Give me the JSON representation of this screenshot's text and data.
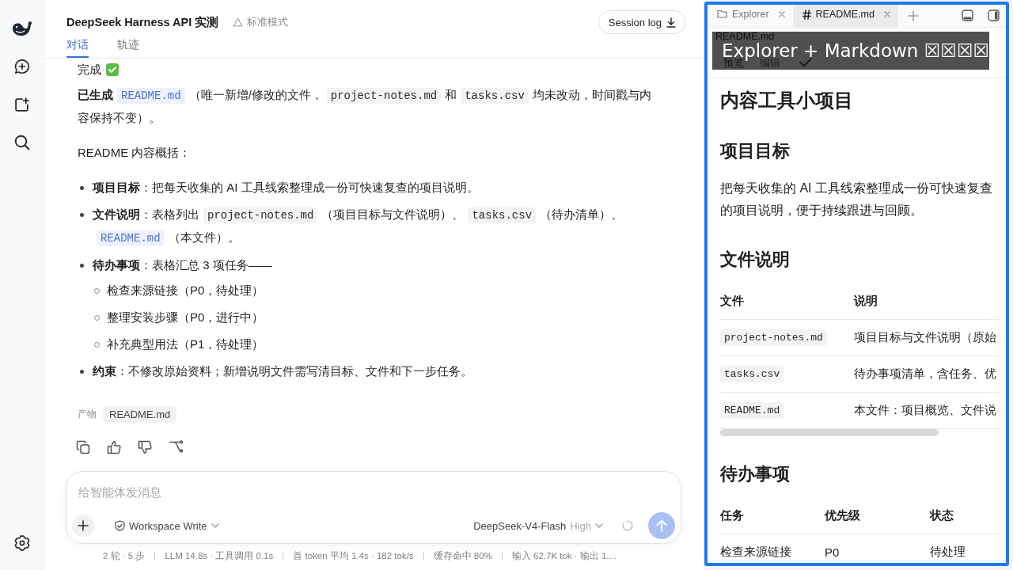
{
  "header": {
    "title": "DeepSeek Harness API 实测",
    "mode": "标准模式",
    "session_button": "Session log",
    "tabs": [
      {
        "label": "对话",
        "selected": true
      },
      {
        "label": "轨迹",
        "selected": false
      }
    ]
  },
  "message": {
    "status": "完成",
    "paragraph": [
      {
        "kind": "bold",
        "text": "已生成"
      },
      {
        "kind": "link",
        "text": "README.md"
      },
      {
        "kind": "text",
        "text": "（唯一新增/修改的文件，"
      },
      {
        "kind": "code",
        "text": "project-notes.md"
      },
      {
        "kind": "text",
        "text": "和"
      },
      {
        "kind": "code",
        "text": "tasks.csv"
      },
      {
        "kind": "text",
        "text": "均未改动，时间戳与内容保持不变）。"
      }
    ],
    "intro": "README 内容概括：",
    "bullets": [
      {
        "segments": [
          {
            "kind": "bold",
            "text": "项目目标"
          },
          {
            "kind": "text",
            "text": "：把每天收集的 AI 工具线索整理成一份可快速复查的项目说明。"
          }
        ]
      },
      {
        "segments": [
          {
            "kind": "bold",
            "text": "文件说明"
          },
          {
            "kind": "text",
            "text": "：表格列出"
          },
          {
            "kind": "code",
            "text": "project-notes.md"
          },
          {
            "kind": "text",
            "text": "（项目目标与文件说明）、"
          },
          {
            "kind": "code",
            "text": "tasks.csv"
          },
          {
            "kind": "text",
            "text": "（待办清单）、"
          },
          {
            "kind": "link",
            "text": "README.md"
          },
          {
            "kind": "text",
            "text": "（本文件）。"
          }
        ]
      },
      {
        "segments": [
          {
            "kind": "bold",
            "text": "待办事项"
          },
          {
            "kind": "text",
            "text": "：表格汇总 3 项任务——"
          }
        ],
        "children": [
          {
            "text": "检查来源链接（P0，待处理）"
          },
          {
            "text": "整理安装步骤（P0，进行中）"
          },
          {
            "text": "补充典型用法（P1，待处理）"
          }
        ]
      },
      {
        "segments": [
          {
            "kind": "bold",
            "text": "约束"
          },
          {
            "kind": "text",
            "text": "：不修改原始资料；新增说明文件需写清目标、文件和下一步任务。"
          }
        ]
      }
    ],
    "artifacts": {
      "label": "产物",
      "files": [
        "README.md"
      ]
    }
  },
  "composer": {
    "placeholder": "给智能体发消息",
    "permission": "Workspace Write",
    "model": "DeepSeek-V4-Flash",
    "effort": "High",
    "send_disabled": true
  },
  "stats": [
    "2 轮 · 5 步",
    "LLM 14.8s · 工具调用 0.1s",
    "首 token 平均 1.4s · 182 tok/s",
    "缓存命中 80%",
    "输入 62.7K tok · 输出 1...."
  ],
  "panel": {
    "tabs": [
      {
        "label": "Explorer",
        "kind": "explorer",
        "selected": false
      },
      {
        "label": "README.md",
        "kind": "markdown",
        "selected": true
      }
    ],
    "path": "README.md",
    "view_tabs": [
      {
        "label": "预览",
        "selected": true
      },
      {
        "label": "编辑",
        "selected": false
      }
    ],
    "caption": "Explorer + Markdown ☒☒☒☒",
    "doc": {
      "title": "内容工具小项目",
      "sections": [
        {
          "heading": "项目目标",
          "kind": "paragraph",
          "text": "把每天收集的 AI 工具线索整理成一份可快速复查的项目说明，便于持续跟进与回顾。"
        },
        {
          "heading": "文件说明",
          "kind": "table",
          "scrollable": true,
          "columns": [
            {
              "label": "文件",
              "kind": "code"
            },
            {
              "label": "说明",
              "kind": "text"
            }
          ],
          "rows": [
            [
              "project-notes.md",
              "项目目标与文件说明（原始"
            ],
            [
              "tasks.csv",
              "待办事项清单，含任务、优"
            ],
            [
              "README.md",
              "本文件：项目概览、文件说"
            ]
          ]
        },
        {
          "heading": "待办事项",
          "kind": "table",
          "columns": [
            {
              "label": "任务",
              "kind": "text"
            },
            {
              "label": "优先级",
              "kind": "text"
            },
            {
              "label": "状态",
              "kind": "text"
            }
          ],
          "rows": [
            [
              "检查来源链接",
              "P0",
              "待处理"
            ]
          ]
        }
      ]
    }
  }
}
